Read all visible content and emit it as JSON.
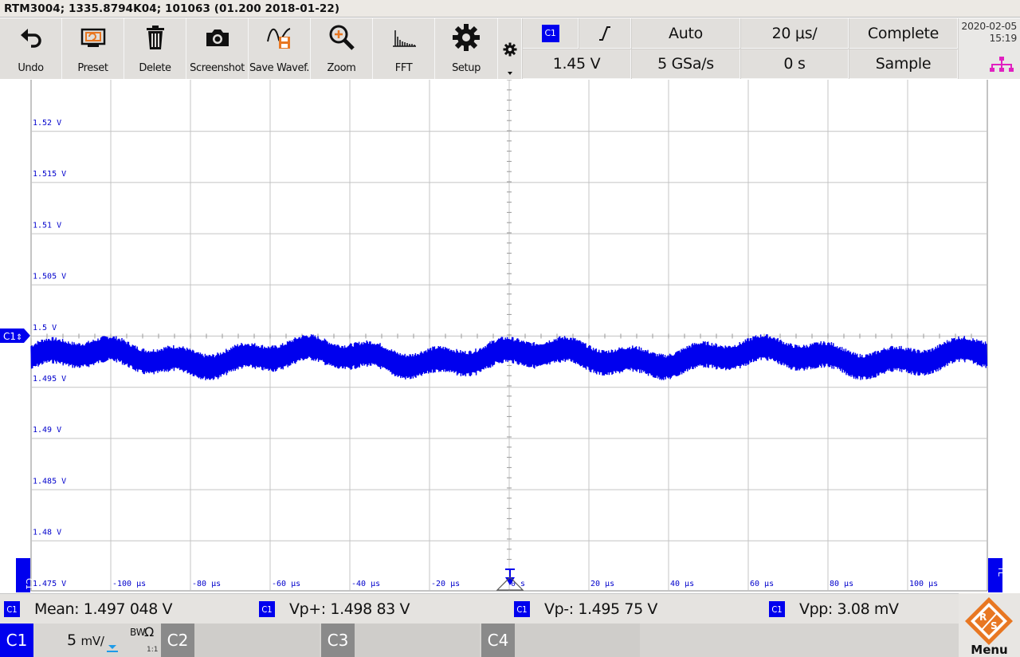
{
  "title_bar": "RTM3004; 1335.8794K04; 101063 (01.200 2018-01-22)",
  "toolbar": [
    {
      "label": "Undo",
      "icon": "undo-icon"
    },
    {
      "label": "Preset",
      "icon": "preset-icon"
    },
    {
      "label": "Delete",
      "icon": "trash-icon"
    },
    {
      "label": "Screenshot",
      "icon": "camera-icon"
    },
    {
      "label": "Save Wavef.",
      "icon": "save-waveform-icon"
    },
    {
      "label": "Zoom",
      "icon": "zoom-icon"
    },
    {
      "label": "FFT",
      "icon": "fft-icon"
    },
    {
      "label": "Setup",
      "icon": "gear-icon"
    }
  ],
  "trigger": {
    "source": "C1",
    "slope_icon": "rising-edge-icon",
    "mode": "Auto",
    "timebase": "20 μs/",
    "acq_status": "Complete",
    "level": "1.45 V",
    "sample_rate": "5 GSa/s",
    "position": "0 s",
    "acq_mode": "Sample"
  },
  "datetime": {
    "date": "2020-02-05",
    "time": "15:19"
  },
  "plot": {
    "y_labels": [
      "1.52 V",
      "1.515 V",
      "1.51 V",
      "1.505 V",
      "1.5 V",
      "1.495 V",
      "1.49 V",
      "1.485 V",
      "1.48 V",
      "1.475 V"
    ],
    "x_labels": [
      "-100 μs",
      "-80 μs",
      "-60 μs",
      "-40 μs",
      "-20 μs",
      "0 s",
      "20 μs",
      "40 μs",
      "60 μs",
      "80 μs",
      "100 μs"
    ],
    "channel_marker": "C1",
    "trigger_marker": "TL",
    "waveform_color": "#0000ee"
  },
  "measurements": [
    {
      "channel": "C1",
      "text": "Mean: 1.497 048 V"
    },
    {
      "channel": "C1",
      "text": "Vp+: 1.498 83 V"
    },
    {
      "channel": "C1",
      "text": "Vp-: 1.495 75 V"
    },
    {
      "channel": "C1",
      "text": "Vpp: 3.08 mV"
    }
  ],
  "channels": [
    {
      "label": "C1",
      "scale": "5",
      "unit": "mV/",
      "bw": "BW",
      "ohm": "Ω",
      "ratio": "1:1"
    },
    {
      "label": "C2"
    },
    {
      "label": "C3"
    },
    {
      "label": "C4"
    }
  ],
  "menu_label": "Menu",
  "colors": {
    "channel1": "#0000ee",
    "accent_orange": "#e87722",
    "lan_icon": "#e020c0"
  }
}
